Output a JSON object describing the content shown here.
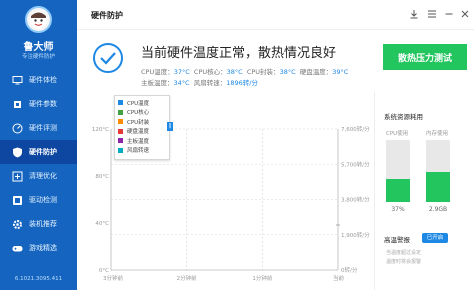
{
  "sidebar": {
    "app_name": "鲁大师",
    "slogan": "专注硬件防护",
    "items": [
      {
        "label": "硬件体检",
        "icon": "monitor-icon",
        "active": false
      },
      {
        "label": "硬件参数",
        "icon": "chip-icon",
        "active": false
      },
      {
        "label": "硬件评测",
        "icon": "gauge-icon",
        "active": false
      },
      {
        "label": "硬件防护",
        "icon": "shield-icon",
        "active": true
      },
      {
        "label": "清理优化",
        "icon": "broom-icon",
        "active": false
      },
      {
        "label": "驱动检测",
        "icon": "driver-icon",
        "active": false
      },
      {
        "label": "装机推荐",
        "icon": "gear-icon",
        "active": false
      },
      {
        "label": "游戏精选",
        "icon": "gamepad-icon",
        "active": false
      }
    ],
    "version": "6.1021.3095.411"
  },
  "header": {
    "title": "硬件防护",
    "controls": [
      "download-icon",
      "menu-icon",
      "minimize-icon",
      "close-icon"
    ]
  },
  "status": {
    "headline": "当前硬件温度正常，散热情况良好",
    "row1": [
      {
        "label": "CPU温度：",
        "value": "37°C"
      },
      {
        "label": "CPU核心：",
        "value": "38°C"
      },
      {
        "label": "CPU封装：",
        "value": "38°C"
      },
      {
        "label": "硬盘温度：",
        "value": "39°C"
      }
    ],
    "row2": [
      {
        "label": "主板温度：",
        "value": "34°C"
      },
      {
        "label": "风扇转速：",
        "value": "1896转/分"
      }
    ],
    "test_button": "散热压力测试"
  },
  "chart_data": {
    "type": "line",
    "y_left_ticks": [
      "120°C",
      "80°C",
      "40°C",
      "0°C"
    ],
    "y_left_range": [
      0,
      120
    ],
    "y_right_ticks": [
      "7,600转/分",
      "5,700转/分",
      "3,800转/分",
      "1,900转/分",
      "0转/分"
    ],
    "y_right_range": [
      0,
      7600
    ],
    "x_ticks": [
      "3分钟前",
      "2分钟前",
      "1分钟前",
      "当前"
    ],
    "grid": true,
    "legend_position": "top-left",
    "series": [
      {
        "name": "CPU温度",
        "color": "#1e88e5",
        "values": []
      },
      {
        "name": "CPU核心",
        "color": "#43a047",
        "values": []
      },
      {
        "name": "CPU封装",
        "color": "#fb8c00",
        "values": []
      },
      {
        "name": "硬盘温度",
        "color": "#e53935",
        "values": []
      },
      {
        "name": "主板温度",
        "color": "#8e24aa",
        "values": []
      },
      {
        "name": "风扇转速",
        "color": "#00acc1",
        "values": []
      }
    ]
  },
  "resources": {
    "title": "系统资源耗用",
    "cpu": {
      "label": "CPU使用",
      "percent": 37,
      "value": "37%"
    },
    "memory": {
      "label": "内存使用",
      "percent": 48,
      "value": "2.9GB"
    }
  },
  "alarm": {
    "title": "高温警报",
    "badge": "已开启",
    "lines": [
      "当温度超过设定",
      "温度时将会报警"
    ]
  }
}
